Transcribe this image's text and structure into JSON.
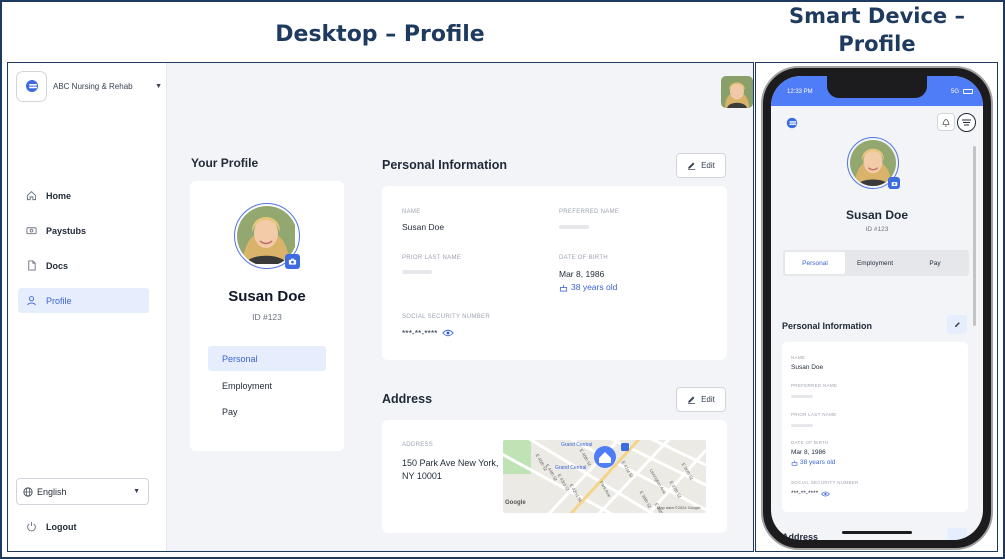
{
  "headings": {
    "desktop": "Desktop – Profile",
    "mobile": "Smart Device – Profile"
  },
  "sidebar": {
    "org_name": "ABC Nursing & Rehab",
    "items": [
      {
        "label": "Home",
        "icon": "home-icon"
      },
      {
        "label": "Paystubs",
        "icon": "paystub-icon"
      },
      {
        "label": "Docs",
        "icon": "document-icon"
      },
      {
        "label": "Profile",
        "icon": "user-icon",
        "active": true
      }
    ],
    "language": "English",
    "logout": "Logout"
  },
  "profile": {
    "section_title": "Your Profile",
    "name": "Susan Doe",
    "id": "ID #123",
    "tabs": [
      "Personal",
      "Employment",
      "Pay"
    ]
  },
  "personal": {
    "title": "Personal Information",
    "edit": "Edit",
    "name_label": "NAME",
    "name": "Susan Doe",
    "preferred_label": "PREFERRED NAME",
    "prior_label": "PRIOR LAST NAME",
    "dob_label": "DATE OF BIRTH",
    "dob": "Mar 8, 1986",
    "age": "38 years old",
    "ssn_label": "SOCIAL SECURITY NUMBER",
    "ssn": "***-**-****"
  },
  "address": {
    "title": "Address",
    "edit": "Edit",
    "label": "ADDRESS",
    "line1": "150 Park Ave New York,",
    "line2": "NY 10001",
    "map": {
      "labels": [
        "Grand Central",
        "Grand Central",
        "E 45th St",
        "E 44th St",
        "E 43rd St",
        "E 42nd St",
        "E 41st St",
        "Park Ave",
        "Lexington Ave",
        "E 39th St",
        "E 38th St",
        "E 37th St",
        "E 36th St",
        "E 40th St"
      ],
      "google": "Google",
      "copyright": "Map data ©2024 Google"
    }
  },
  "mobile": {
    "time": "12:33 PM",
    "signal": "5G",
    "name_label": "NAME",
    "preferred_label": "PREFERRED NAME",
    "prior_label": "PRIOR LAST NAME",
    "dob_label": "DATE OF BIRTH",
    "ssn_label": "SOCIAL SECURITY NUMBER",
    "address_peek": "Address"
  },
  "colors": {
    "accent": "#3d6be0",
    "status_bar": "#4f7cf7",
    "frame": "#1e3a5f"
  }
}
